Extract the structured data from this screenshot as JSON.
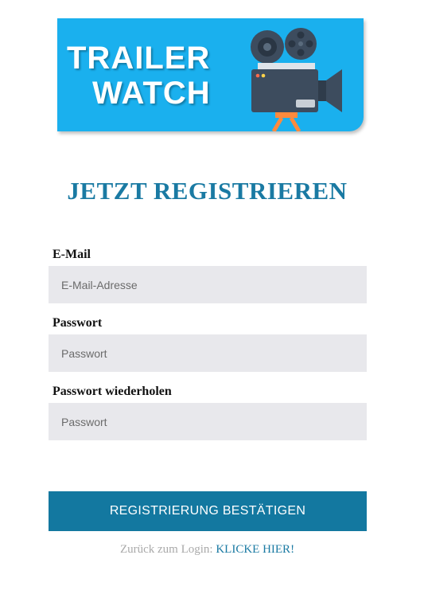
{
  "logo": {
    "line1": "TRAILER",
    "line2": "WATCH",
    "icon": "film-camera-icon",
    "background_color": "#1ab0ee"
  },
  "page": {
    "title": "JETZT REGISTRIEREN"
  },
  "form": {
    "email": {
      "label": "E-Mail",
      "placeholder": "E-Mail-Adresse",
      "value": ""
    },
    "password": {
      "label": "Passwort",
      "placeholder": "Passwort",
      "value": ""
    },
    "password_repeat": {
      "label": "Passwort wiederholen",
      "placeholder": "Passwort",
      "value": ""
    },
    "submit_label": "REGISTRIERUNG BESTÄTIGEN"
  },
  "footer": {
    "back_text": "Zurück zum Login:",
    "link_text": "KLICKE HIER!"
  },
  "colors": {
    "accent": "#1378a0",
    "title": "#1a7aa3",
    "input_background": "#e8e8ec"
  }
}
